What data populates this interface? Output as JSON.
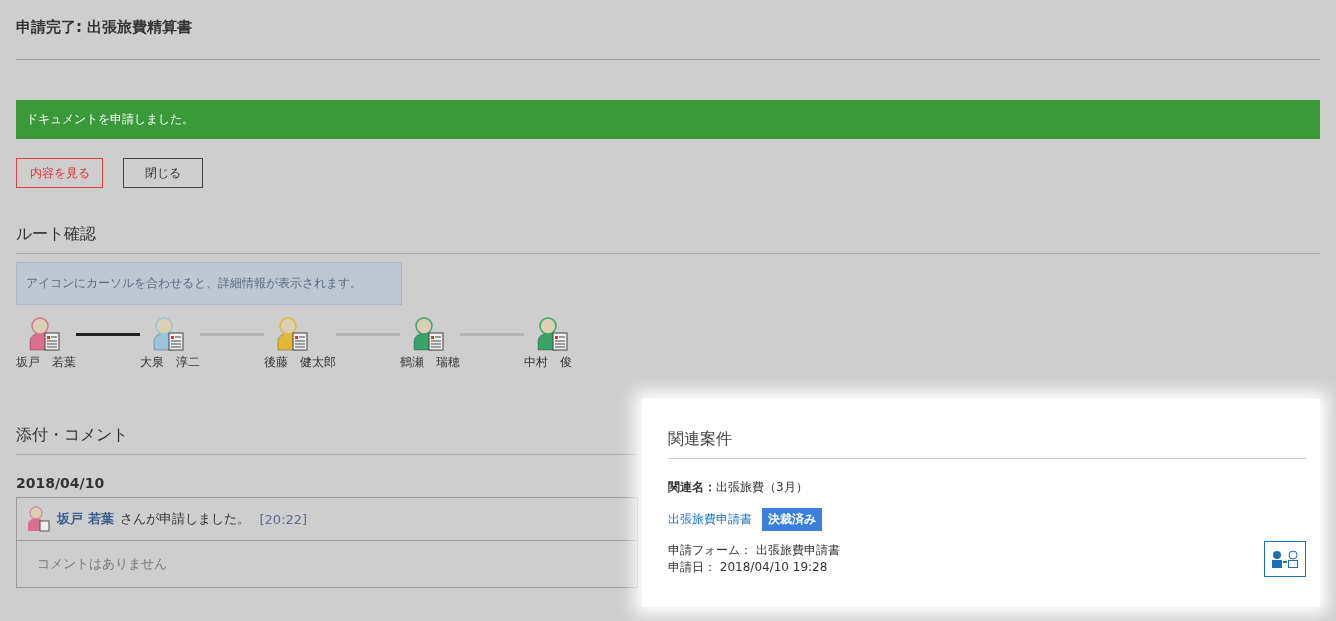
{
  "title": "申請完了: 出張旅費精算書",
  "alert": "ドキュメントを申請しました。",
  "buttons": [
    {
      "label": "内容を見る",
      "kind": "primary"
    },
    {
      "label": "閉じる",
      "kind": "default"
    }
  ],
  "route": {
    "heading": "ルート確認",
    "hint": "アイコンにカーソルを合わせると、詳細情報が表示されます。",
    "approvers": [
      {
        "name": "坂戸　若葉",
        "color": "#d9708f"
      },
      {
        "name": "大泉　淳二",
        "color": "#9cc3da"
      },
      {
        "name": "後藤　健太郎",
        "color": "#e0b83a"
      },
      {
        "name": "鶴瀬　瑞穂",
        "color": "#3aa36a"
      },
      {
        "name": "中村　俊",
        "color": "#3aa36a"
      }
    ],
    "connectors": [
      {
        "completed": true
      },
      {
        "completed": false
      },
      {
        "completed": false
      },
      {
        "completed": false
      }
    ]
  },
  "comments": {
    "heading": "添付・コメント",
    "date": "2018/04/10",
    "user": "坂戸 若葉",
    "action": "さんが申請しました。",
    "time": "[20:22]",
    "empty": "コメントはありません"
  },
  "related": {
    "heading": "関連案件",
    "name_label": "関連名：",
    "name": "出張旅費（3月）",
    "link": "出張旅費申請書",
    "badge": "決裁済み",
    "form": "申請フォーム： 出張旅費申請書",
    "date": "申請日： 2018/04/10 19:28"
  }
}
